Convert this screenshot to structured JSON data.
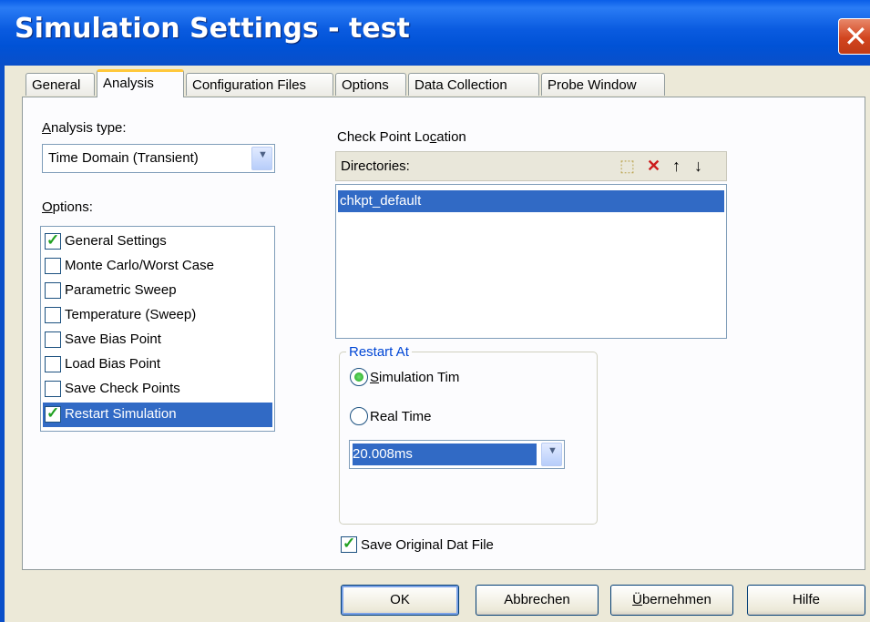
{
  "window": {
    "title": "Simulation Settings - test",
    "close_glyph": "✕"
  },
  "tabs": [
    {
      "label": "General"
    },
    {
      "label": "Analysis"
    },
    {
      "label": "Configuration Files"
    },
    {
      "label": "Options"
    },
    {
      "label": "Data Collection"
    },
    {
      "label": "Probe Window"
    }
  ],
  "analysis": {
    "type_label_pre": "",
    "type_label_key": "A",
    "type_label_post": "nalysis type:",
    "type_value": "Time Domain (Transient)",
    "options_label_key": "O",
    "options_label_post": "ptions:",
    "options": [
      {
        "label": "General Settings",
        "checked": true,
        "selected": false
      },
      {
        "label": "Monte Carlo/Worst Case",
        "checked": false,
        "selected": false
      },
      {
        "label": "Parametric Sweep",
        "checked": false,
        "selected": false
      },
      {
        "label": "Temperature (Sweep)",
        "checked": false,
        "selected": false
      },
      {
        "label": "Save Bias Point",
        "checked": false,
        "selected": false
      },
      {
        "label": "Load Bias Point",
        "checked": false,
        "selected": false
      },
      {
        "label": "Save Check Points",
        "checked": false,
        "selected": false
      },
      {
        "label": "Restart Simulation",
        "checked": true,
        "selected": true
      }
    ]
  },
  "checkpoint": {
    "location_label_pre": "Check Point Lo",
    "location_label_key": "c",
    "location_label_post": "ation",
    "directories_label": "Directories:",
    "directories": [
      "chkpt_default"
    ],
    "icons": [
      "new-folder-icon",
      "delete-icon",
      "move-up-icon",
      "move-down-icon"
    ]
  },
  "restart": {
    "legend": "Restart At",
    "sim_time_key": "S",
    "sim_time_post": "imulation Tim",
    "real_time_label": "Real Time",
    "selected": "simulation",
    "time_value": "20.008ms"
  },
  "save_original": {
    "label": "Save Original Dat File",
    "checked": true
  },
  "buttons": {
    "ok": "OK",
    "cancel": "Abbrechen",
    "apply_key": "Ü",
    "apply_post": "bernehmen",
    "help": "Hilfe"
  },
  "colors": {
    "selection": "#316ac5",
    "title_bar": "#0a5be0",
    "check": "#21a121"
  }
}
